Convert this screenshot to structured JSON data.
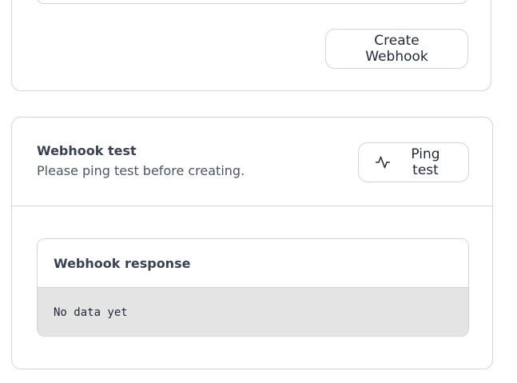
{
  "create_card": {
    "create_button_label": "Create Webhook"
  },
  "test_card": {
    "title": "Webhook test",
    "description": "Please ping test before creating.",
    "ping_button_label": "Ping test",
    "ping_icon": "activity-pulse-icon"
  },
  "response": {
    "title": "Webhook response",
    "body": "No data yet"
  }
}
